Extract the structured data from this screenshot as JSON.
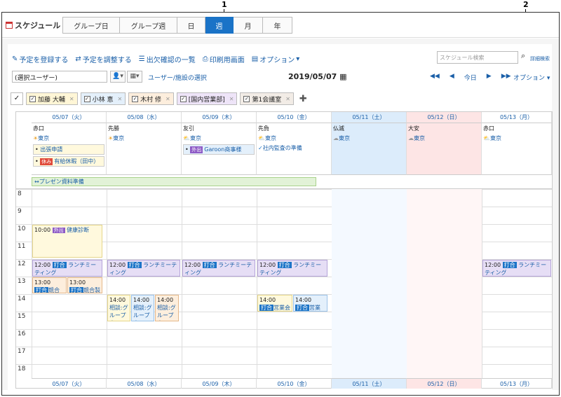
{
  "callouts": {
    "one": "1",
    "two": "2"
  },
  "header": {
    "title": "スケジュール",
    "tabs": [
      "グループ日",
      "グループ週",
      "日",
      "週",
      "月",
      "年"
    ]
  },
  "actions": {
    "register": "予定を登録する",
    "adjust": "予定を調整する",
    "attendance": "出欠確認の一覧",
    "print": "印刷用画面",
    "options": "オプション",
    "search_placeholder": "スケジュール検索",
    "advanced_search": "詳細検索"
  },
  "toolbar": {
    "user_select": "(選択ユーザー)",
    "user_facility_link": "ユーザー/施設の選択",
    "current_date": "2019/05/07",
    "today": "今日",
    "options": "オプション"
  },
  "filters": [
    {
      "label": "加藤 大輔",
      "color": "#fff6d6"
    },
    {
      "label": "小林 恵",
      "color": "#e4f0fb"
    },
    {
      "label": "木村 修",
      "color": "#fdeedd"
    },
    {
      "label": "[国内営業部]",
      "color": "#eee4f8"
    },
    {
      "label": "第1会議室",
      "color": "#f2ece6"
    }
  ],
  "days": [
    {
      "label": "05/07（火）",
      "rokuyo": "赤口",
      "weather": "東京",
      "kind": "weekday"
    },
    {
      "label": "05/08（水）",
      "rokuyo": "先勝",
      "weather": "東京",
      "kind": "weekday"
    },
    {
      "label": "05/09（木）",
      "rokuyo": "友引",
      "weather": "東京",
      "kind": "weekday"
    },
    {
      "label": "05/10（金）",
      "rokuyo": "先負",
      "weather": "東京",
      "kind": "weekday"
    },
    {
      "label": "05/11（土）",
      "rokuyo": "仏滅",
      "weather": "東京",
      "kind": "sat"
    },
    {
      "label": "05/12（日）",
      "rokuyo": "大安",
      "weather": "東京",
      "kind": "sun"
    },
    {
      "label": "05/13（月）",
      "rokuyo": "赤口",
      "weather": "東京",
      "kind": "weekday"
    }
  ],
  "allday": {
    "e1": "出張申請",
    "e2_tag": "休み",
    "e2": "有給休暇（田中）",
    "e3_tag": "外出",
    "e3": "Garoon商事様",
    "e4": "社内監査の準備",
    "banner": "プレゼン資料準備"
  },
  "hours": [
    "8",
    "9",
    "10",
    "11",
    "12",
    "13",
    "14",
    "15",
    "16",
    "17",
    "18"
  ],
  "appts": {
    "health_time": "10:00",
    "health_tag": "外出",
    "health": "健康診断",
    "lunch_time": "12:00",
    "lunch_tag": "打合",
    "lunch": "ランチミーティング",
    "t1300": "13:00",
    "mtg_tag": "打合",
    "mtg": "競合製品調査",
    "t1400": "14:00",
    "consult": "相談:グループウェア",
    "sales": "営業会議"
  }
}
